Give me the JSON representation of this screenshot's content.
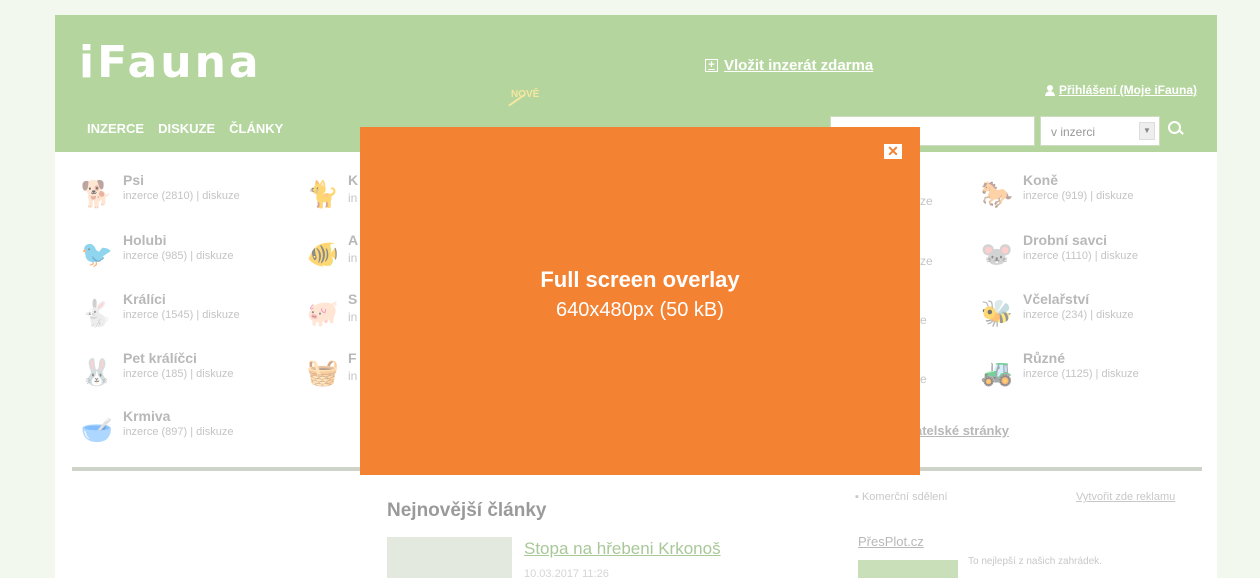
{
  "header": {
    "logo": "iFauna",
    "post_ad": "Vložit inzerát zdarma",
    "login": "Přihlášení (Moje iFauna)",
    "new_tag": "NOVĚ",
    "nav": [
      "INZERCE",
      "DISKUZE",
      "ČLÁNKY"
    ],
    "search_select": "v inzerci"
  },
  "categories": [
    {
      "name": "Psi",
      "sub": "inzerce (2810) | diskuze",
      "icon": "dog-icon"
    },
    {
      "name": "Holubi",
      "sub": "inzerce (985) | diskuze",
      "icon": "pigeon-icon"
    },
    {
      "name": "Králíci",
      "sub": "inzerce (1545) | diskuze",
      "icon": "rabbit-icon"
    },
    {
      "name": "Pet králíčci",
      "sub": "inzerce (185) | diskuze",
      "icon": "bunny-icon"
    },
    {
      "name": "Krmiva",
      "sub": "inzerce (897) | diskuze",
      "icon": "feed-bowl-icon"
    },
    {
      "name": "Koně",
      "sub": "inzerce (919) | diskuze",
      "icon": "horse-icon"
    },
    {
      "name": "Drobní savci",
      "sub": "inzerce (1110) | diskuze",
      "icon": "chinchilla-icon"
    },
    {
      "name": "Včelařství",
      "sub": "inzerce (234) | diskuze",
      "icon": "bee-icon"
    },
    {
      "name": "Různé",
      "sub": "inzerce (1125) | diskuze",
      "icon": "tractor-icon"
    }
  ],
  "partials": {
    "col2_letters": [
      "K",
      "A",
      "S",
      "F"
    ],
    "col2_text": [
      "in",
      "in",
      "in",
      "in"
    ],
    "col3_text": [
      "ze",
      "ze",
      "e",
      "e"
    ],
    "friend_pages": "atelské stránky"
  },
  "articles": {
    "title": "Nejnovější články",
    "first_link": "Stopa na hřebeni Krkonoš",
    "first_date": "10.03.2017 11:26"
  },
  "sidebar": {
    "commercial": "▪ Komerční sdělení",
    "create_ad": "Vytvořit zde reklamu",
    "partner": "PřesPlot.cz",
    "partner_text": "To nejlepší z našich zahrádek."
  },
  "overlay": {
    "title": "Full screen overlay",
    "size": "640x480px (50 kB)",
    "close_symbol": "✕"
  },
  "colors": {
    "header_green": "#b4d59d",
    "overlay_orange": "#f38233"
  }
}
